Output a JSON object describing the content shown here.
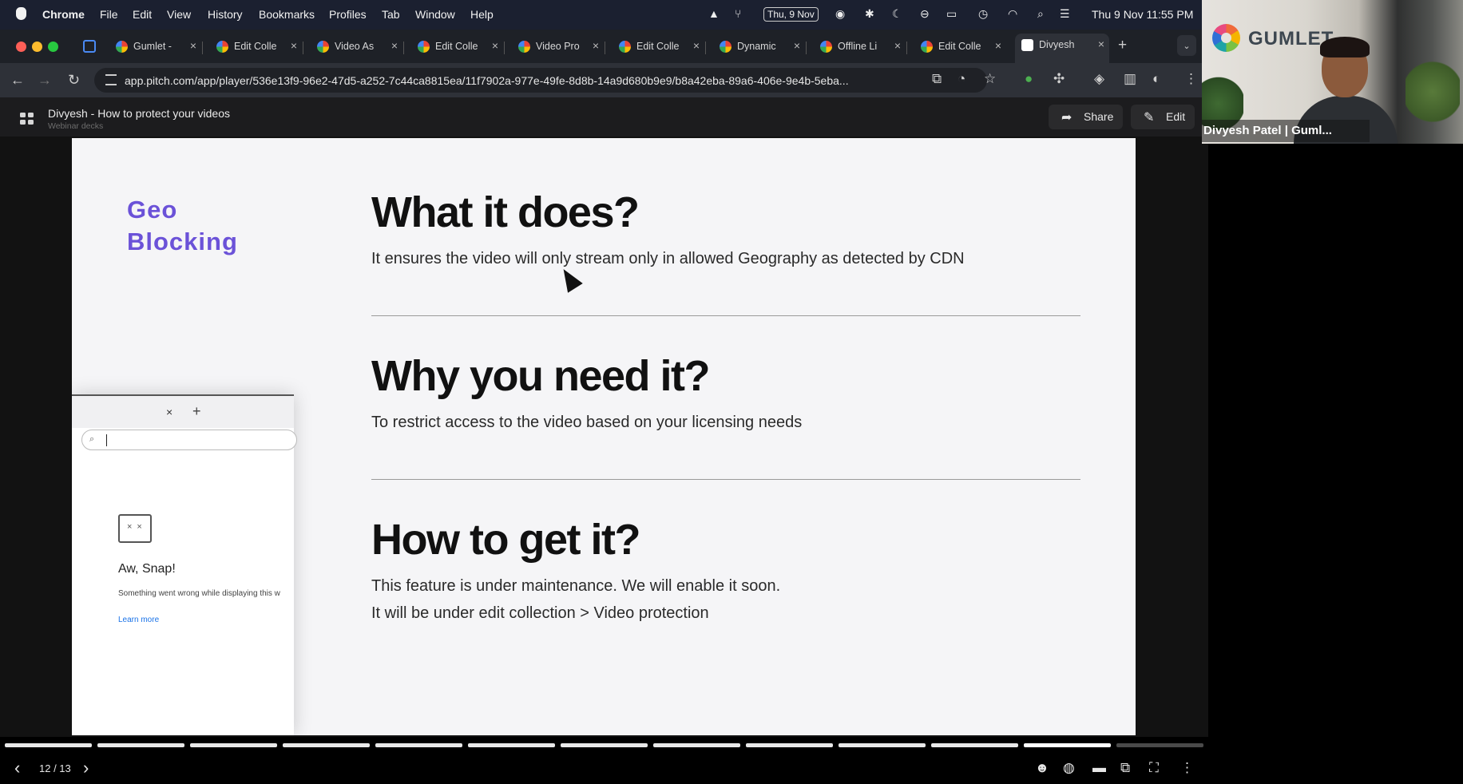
{
  "menubar": {
    "app": "Chrome",
    "menus": [
      "File",
      "Edit",
      "View",
      "History",
      "Bookmarks",
      "Profiles",
      "Tab",
      "Window",
      "Help"
    ],
    "date_badge": "Thu, 9 Nov",
    "clock": "Thu 9 Nov  11:55 PM"
  },
  "tabs": [
    {
      "label": "Gumlet -"
    },
    {
      "label": "Edit Colle"
    },
    {
      "label": "Video As"
    },
    {
      "label": "Edit Colle"
    },
    {
      "label": "Video Pro"
    },
    {
      "label": "Edit Colle"
    },
    {
      "label": "Dynamic"
    },
    {
      "label": "Offline Li"
    },
    {
      "label": "Edit Colle"
    },
    {
      "label": "Divyesh"
    }
  ],
  "address_bar": {
    "url": "app.pitch.com/app/player/536e13f9-96e2-47d5-a252-7c44ca8815ea/11f7902a-977e-49fe-8d8b-14a9d680b9e9/b8a42eba-89a6-406e-9e4b-5eba..."
  },
  "app_header": {
    "title": "Divyesh - How to protect your videos",
    "subtitle": "Webinar decks",
    "share_label": "Share",
    "edit_label": "Edit"
  },
  "slide": {
    "topic_line1": "Geo",
    "topic_line2": "Blocking",
    "sections": [
      {
        "heading": "What it does?",
        "lines": [
          "It ensures the video will only stream only in allowed Geography as detected by CDN"
        ]
      },
      {
        "heading": "Why you need it?",
        "lines": [
          "To restrict access to the video based on your licensing needs"
        ]
      },
      {
        "heading": "How to get it?",
        "lines": [
          "This feature is under maintenance. We will enable it soon.",
          "It will be under edit collection > Video protection"
        ]
      }
    ],
    "embedded_browser": {
      "tab_close": "×",
      "new_tab": "+",
      "error_title": "Aw, Snap!",
      "error_message": "Something went wrong while displaying this w",
      "learn_more": "Learn more"
    }
  },
  "player": {
    "slide_counter": "12 / 13",
    "current_slide": 12,
    "total_slides": 13
  },
  "webcam": {
    "brand": "GUMLET",
    "participant_name": "Divyesh Patel | Guml..."
  },
  "colors": {
    "accent_topic": "#6b52d8",
    "slide_bg": "#f5f5f7",
    "chrome_dark": "#2e3138"
  }
}
